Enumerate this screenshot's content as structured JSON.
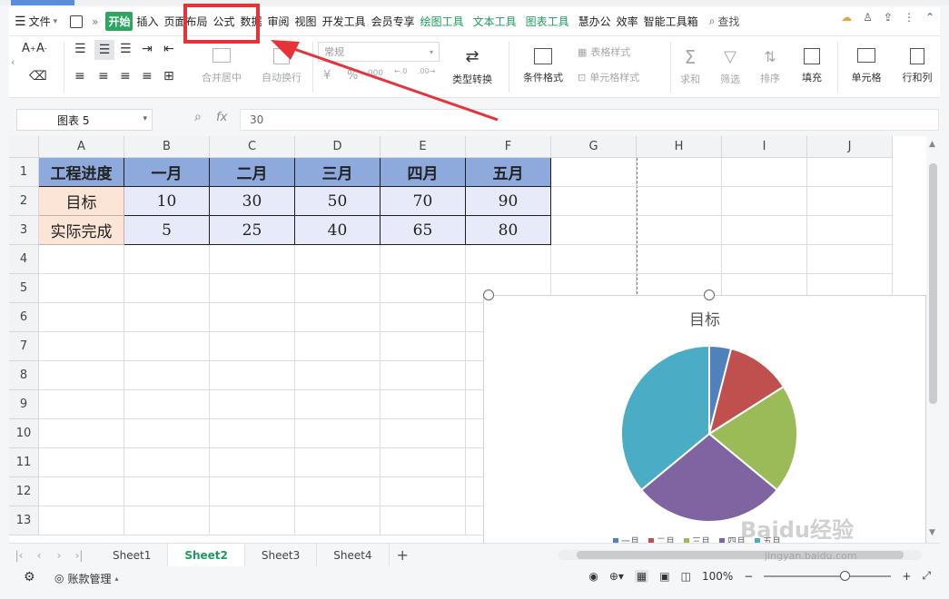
{
  "menu": {
    "file_label": "文件",
    "more_label": "»"
  },
  "tabs": [
    {
      "label": "开始",
      "style": "start"
    },
    {
      "label": "插入",
      "style": "normal"
    },
    {
      "label": "页面布局",
      "style": "normal"
    },
    {
      "label": "公式",
      "style": "normal"
    },
    {
      "label": "数据",
      "style": "normal"
    },
    {
      "label": "审阅",
      "style": "normal"
    },
    {
      "label": "视图",
      "style": "normal"
    },
    {
      "label": "开发工具",
      "style": "normal"
    },
    {
      "label": "会员专享",
      "style": "normal"
    },
    {
      "label": "绘图工具",
      "style": "green"
    },
    {
      "label": "文本工具",
      "style": "green"
    },
    {
      "label": "图表工具",
      "style": "green"
    },
    {
      "label": "慧办公",
      "style": "normal"
    },
    {
      "label": "效率",
      "style": "normal"
    },
    {
      "label": "智能工具箱",
      "style": "normal"
    }
  ],
  "search_label": "查找",
  "ribbon": {
    "merge_center": "合并居中",
    "wrap_text": "自动换行",
    "number_format": "常规",
    "currency_symbol": "¥",
    "type_convert": "类型转换",
    "conditional_format": "条件格式",
    "table_style": "表格样式",
    "cell_style": "单元格样式",
    "sum": "求和",
    "filter": "筛选",
    "sort": "排序",
    "fill": "填充",
    "cell": "单元格",
    "row_col": "行和列"
  },
  "formula_bar": {
    "name_box": "图表 5",
    "fx_label": "fx",
    "value": "30"
  },
  "columns": [
    "A",
    "B",
    "C",
    "D",
    "E",
    "F",
    "G",
    "H",
    "I",
    "J"
  ],
  "rows": [
    "1",
    "2",
    "3",
    "4",
    "5",
    "6",
    "7",
    "8",
    "9",
    "10",
    "11",
    "12",
    "13"
  ],
  "table": {
    "header": [
      "工程进度",
      "一月",
      "二月",
      "三月",
      "四月",
      "五月"
    ],
    "rows": [
      [
        "目标",
        "10",
        "30",
        "50",
        "70",
        "90"
      ],
      [
        "实际完成",
        "5",
        "25",
        "40",
        "65",
        "80"
      ]
    ]
  },
  "chart_data": {
    "type": "pie",
    "title": "目标",
    "categories": [
      "一月",
      "二月",
      "三月",
      "四月",
      "五月"
    ],
    "values": [
      10,
      30,
      50,
      70,
      90
    ],
    "colors": [
      "#4f81bd",
      "#c0504d",
      "#9bbb59",
      "#8064a2",
      "#4bacc6"
    ],
    "legend_position": "bottom"
  },
  "sheets": [
    {
      "label": "Sheet1",
      "active": false
    },
    {
      "label": "Sheet2",
      "active": true
    },
    {
      "label": "Sheet3",
      "active": false
    },
    {
      "label": "Sheet4",
      "active": false
    }
  ],
  "status": {
    "account_label": "账款管理",
    "zoom": "100%"
  },
  "watermark": {
    "brand": "Baidu经验",
    "url": "jingyan.baidu.com"
  },
  "annotation_color": "#e8323a"
}
